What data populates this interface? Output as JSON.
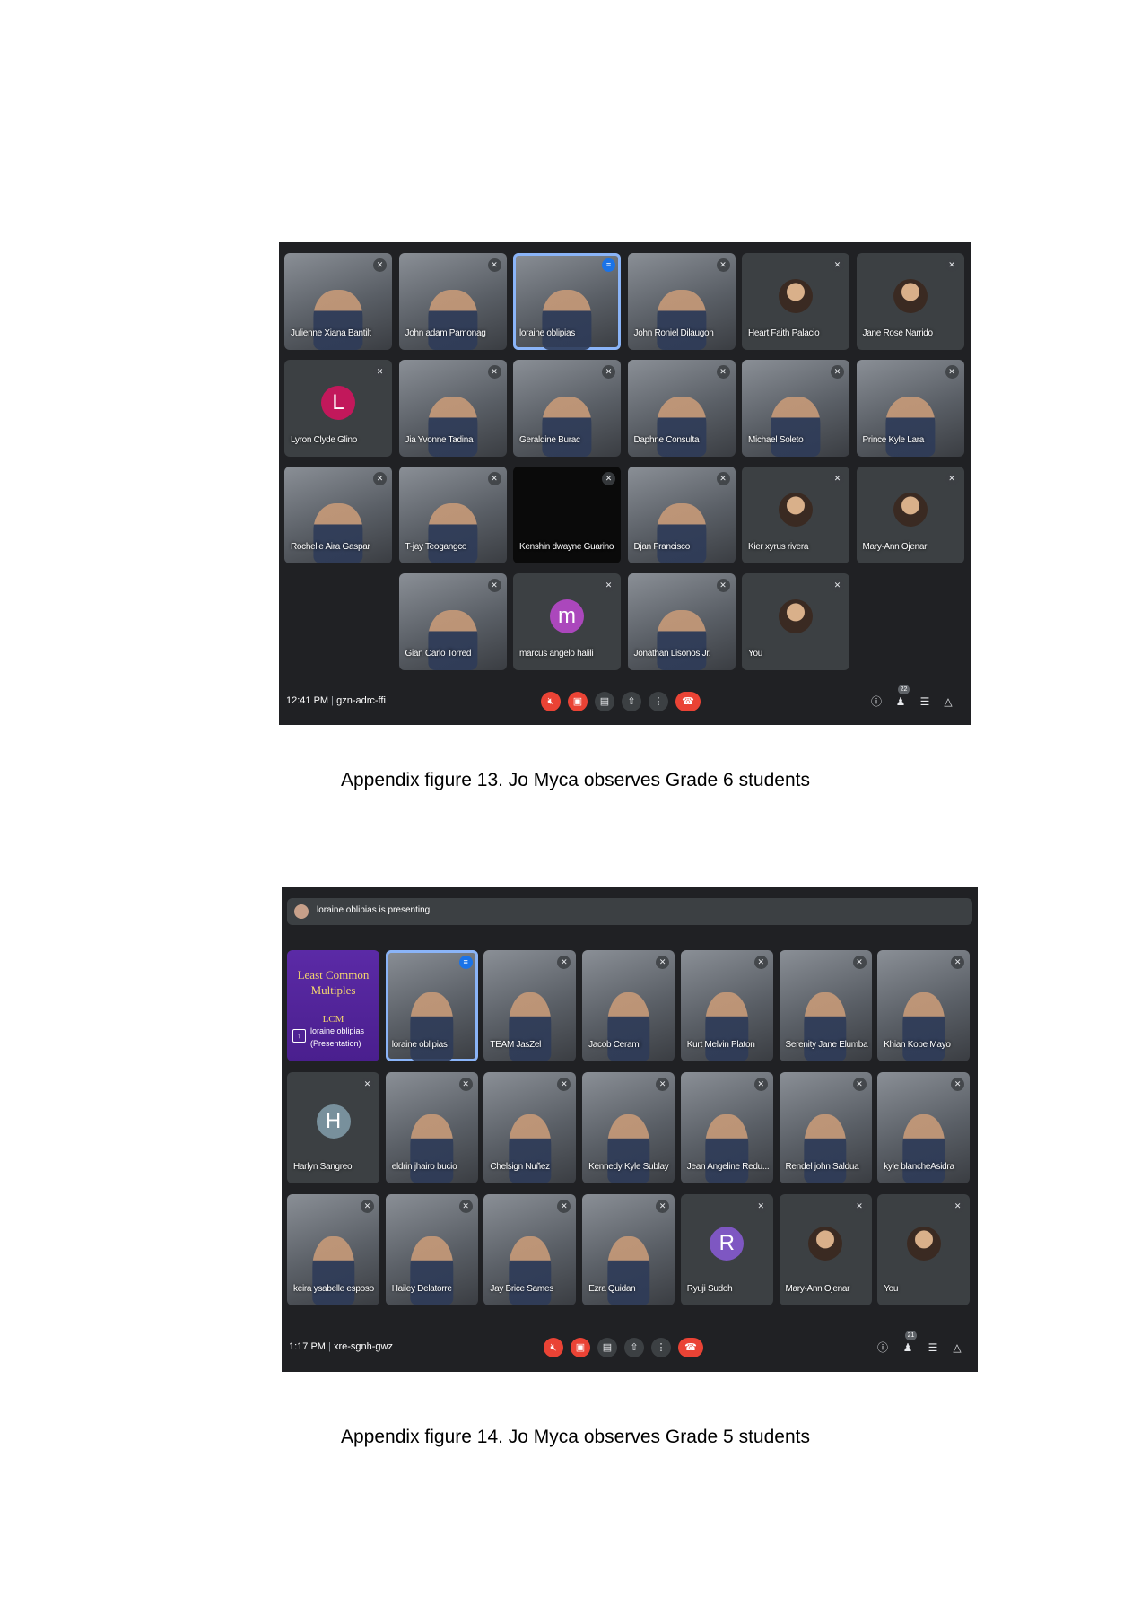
{
  "figure13": {
    "caption": "Appendix figure 13. Jo Myca observes Grade 6 students",
    "time": "12:41 PM",
    "meeting_code": "gzn-adrc-ffi",
    "participant_count": "22",
    "participants": [
      {
        "name": "Julienne Xiana Bantilt",
        "kind": "video"
      },
      {
        "name": "John adam Pamonag",
        "kind": "video"
      },
      {
        "name": "loraine oblipias",
        "kind": "video",
        "active": true
      },
      {
        "name": "John Roniel Dilaugon",
        "kind": "video"
      },
      {
        "name": "Heart Faith Palacio",
        "kind": "photo"
      },
      {
        "name": "Jane Rose Narrido",
        "kind": "photo"
      },
      {
        "name": "Lyron Clyde Glino",
        "kind": "avatar",
        "letter": "L",
        "color": "#c2185b"
      },
      {
        "name": "Jia Yvonne Tadina",
        "kind": "video"
      },
      {
        "name": "Geraldine Burac",
        "kind": "video"
      },
      {
        "name": "Daphne Consulta",
        "kind": "video"
      },
      {
        "name": "Michael Soleto",
        "kind": "video"
      },
      {
        "name": "Prince Kyle Lara",
        "kind": "video"
      },
      {
        "name": "Rochelle Aira Gaspar",
        "kind": "video"
      },
      {
        "name": "T-jay Teogangco",
        "kind": "video"
      },
      {
        "name": "Kenshin dwayne Guarino",
        "kind": "dark"
      },
      {
        "name": "Djan Francisco",
        "kind": "video"
      },
      {
        "name": "Kier xyrus rivera",
        "kind": "photo"
      },
      {
        "name": "Mary-Ann Ojenar",
        "kind": "photo"
      },
      {
        "name": "Gian Carlo Torred",
        "kind": "video"
      },
      {
        "name": "marcus angelo halili",
        "kind": "avatar",
        "letter": "m",
        "color": "#ab47bc"
      },
      {
        "name": "Jonathan Lisonos Jr.",
        "kind": "video"
      },
      {
        "name": "You",
        "kind": "photo"
      }
    ]
  },
  "figure14": {
    "caption": "Appendix figure 14. Jo Myca observes Grade 5 students",
    "presenting_banner": "loraine oblipias is presenting",
    "time": "1:17 PM",
    "meeting_code": "xre-sgnh-gwz",
    "participant_count": "21",
    "slide": {
      "line1": "Least Common",
      "line2": "Multiples",
      "line3": "LCM",
      "owner": "loraine oblipias",
      "tag": "(Presentation)"
    },
    "participants": [
      {
        "name": "",
        "kind": "slide"
      },
      {
        "name": "loraine oblipias",
        "kind": "video",
        "active": true
      },
      {
        "name": "TEAM JasZel",
        "kind": "video"
      },
      {
        "name": "Jacob Cerami",
        "kind": "video"
      },
      {
        "name": "Kurt Melvin Platon",
        "kind": "video"
      },
      {
        "name": "Serenity Jane Elumba",
        "kind": "video"
      },
      {
        "name": "Khian Kobe Mayo",
        "kind": "video"
      },
      {
        "name": "Harlyn Sangreo",
        "kind": "avatar",
        "letter": "H",
        "color": "#78909c"
      },
      {
        "name": "eldrin jhairo bucio",
        "kind": "video"
      },
      {
        "name": "Chelsign Nuñez",
        "kind": "video"
      },
      {
        "name": "Kennedy Kyle Sublay",
        "kind": "video"
      },
      {
        "name": "Jean Angeline Redu...",
        "kind": "video"
      },
      {
        "name": "Rendel john Saldua",
        "kind": "video"
      },
      {
        "name": "kyle blancheAsidra",
        "kind": "video"
      },
      {
        "name": "keira ysabelle esposo",
        "kind": "video"
      },
      {
        "name": "Hailey Delatorre",
        "kind": "video"
      },
      {
        "name": "Jay Brice Sames",
        "kind": "video"
      },
      {
        "name": "Ezra Quidan",
        "kind": "video"
      },
      {
        "name": "Ryuji Sudoh",
        "kind": "avatar",
        "letter": "R",
        "color": "#7e57c2"
      },
      {
        "name": "Mary-Ann Ojenar",
        "kind": "photo"
      },
      {
        "name": "You",
        "kind": "photo"
      }
    ]
  },
  "icons": [
    "mic-off-icon",
    "camera-off-icon",
    "captions-icon",
    "present-icon",
    "more-icon",
    "hang-up-icon",
    "info-icon",
    "people-icon",
    "chat-icon",
    "activities-icon"
  ],
  "colors": {
    "meet_background": "#202124",
    "tile": "#3c4043",
    "danger": "#ea4335",
    "active_outline": "#8ab4f8"
  }
}
